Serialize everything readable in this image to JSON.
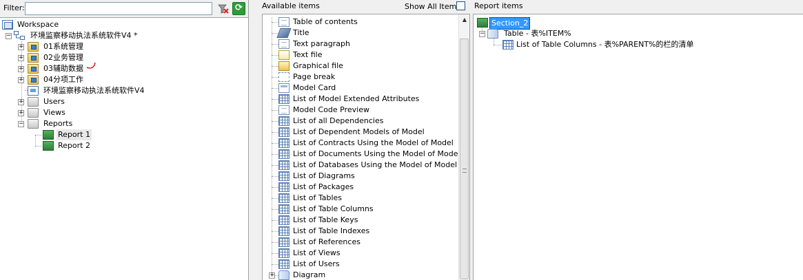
{
  "filter": {
    "label": "Filter:",
    "value": ""
  },
  "tree": {
    "workspace": "Workspace",
    "project": "环境监察移动执法系统软件V4 *",
    "packages": [
      "01系统管理",
      "02业务管理",
      "03辅助数据",
      "04分项工作"
    ],
    "model": "环境监察移动执法系统软件V4",
    "users": "Users",
    "views": "Views",
    "reports": "Reports",
    "report_items": [
      "Report 1",
      "Report 2"
    ]
  },
  "available": {
    "title": "Available items",
    "show_all_label": "Show All Items",
    "items": [
      "Table of contents",
      "Title",
      "Text paragraph",
      "Text file",
      "Graphical file",
      "Page break",
      "Model Card",
      "List of Model Extended Attributes",
      "Model Code Preview",
      "List of all Dependencies",
      "List of Dependent Models of Model",
      "List of Contracts Using the Model of Model",
      "List of Documents Using the Model of Model",
      "List of Databases Using the Model of Model",
      "List of Diagrams",
      "List of Packages",
      "List of Tables",
      "List of Table Columns",
      "List of Table Keys",
      "List of Table Indexes",
      "List of References",
      "List of Views",
      "List of Users",
      "Diagram"
    ],
    "icons": [
      "toc-icon",
      "title-icon",
      "text-paragraph-icon",
      "text-file-icon",
      "graphical-file-icon",
      "page-break-icon",
      "model-card-icon",
      "table-list-icon",
      "code-preview-icon",
      "table-list-icon",
      "table-list-icon",
      "table-list-icon",
      "table-list-icon",
      "table-list-icon",
      "table-list-icon",
      "table-list-icon",
      "table-list-icon",
      "table-list-icon",
      "table-list-icon",
      "table-list-icon",
      "table-list-icon",
      "table-list-icon",
      "table-list-icon",
      "diagram-icon"
    ]
  },
  "report": {
    "title": "Report items",
    "section": "Section_2",
    "table": "Table - 表%ITEM%",
    "columns": "List of Table Columns - 表%PARENT%的栏的清单"
  },
  "colors": {
    "selection": "#3399ff",
    "report_icon": "#2f7f38",
    "refresh": "#2d9c3a"
  }
}
